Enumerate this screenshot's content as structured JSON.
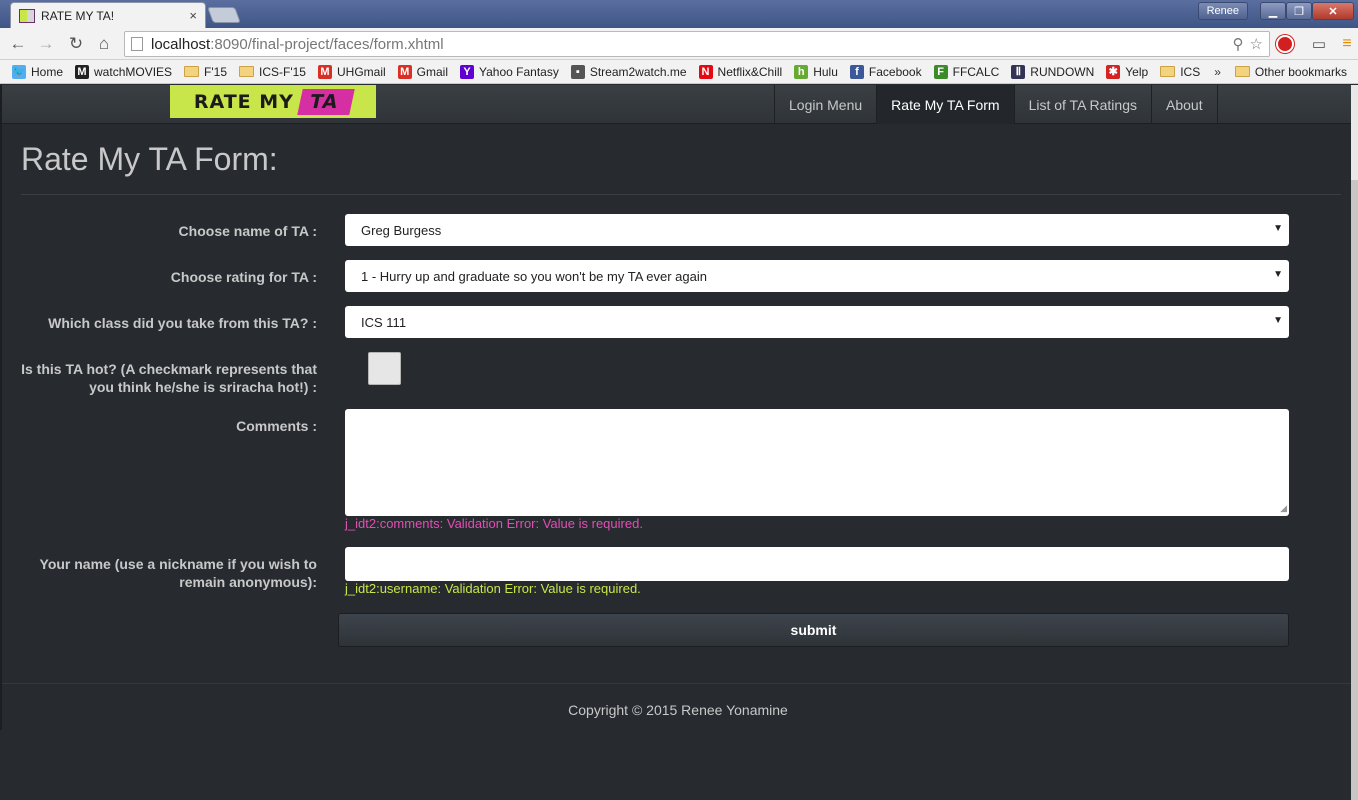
{
  "browser": {
    "tab_title": "RATE MY TA!",
    "tab_close": "×",
    "user_label": "Renee",
    "url_host": "localhost",
    "url_path": ":8090/final-project/faces/form.xhtml",
    "win_min": "▁",
    "win_max": "❐",
    "win_close": "✕"
  },
  "bookmarks": [
    {
      "label": "Home",
      "icon": "twitter-icon",
      "color": "#55acee",
      "glyph": "🐦"
    },
    {
      "label": "watchMOVIES",
      "icon": "m-icon",
      "color": "#222222",
      "glyph": "M"
    },
    {
      "label": "F'15",
      "icon": "folder-icon"
    },
    {
      "label": "ICS-F'15",
      "icon": "folder-icon"
    },
    {
      "label": "UHGmail",
      "icon": "gmail-icon",
      "color": "#d93025",
      "glyph": "M"
    },
    {
      "label": "Gmail",
      "icon": "gmail-icon",
      "color": "#d93025",
      "glyph": "M"
    },
    {
      "label": "Yahoo Fantasy",
      "icon": "yahoo-icon",
      "color": "#5f01d1",
      "glyph": "Y"
    },
    {
      "label": "Stream2watch.me",
      "icon": "stream-icon",
      "color": "#555555",
      "glyph": "▪"
    },
    {
      "label": "Netflix&Chill",
      "icon": "netflix-icon",
      "color": "#e50914",
      "glyph": "N"
    },
    {
      "label": "Hulu",
      "icon": "hulu-icon",
      "color": "#66aa33",
      "glyph": "h"
    },
    {
      "label": "Facebook",
      "icon": "facebook-icon",
      "color": "#3b5998",
      "glyph": "f"
    },
    {
      "label": "FFCALC",
      "icon": "ffcalc-icon",
      "color": "#3d8a2a",
      "glyph": "F"
    },
    {
      "label": "RUNDOWN",
      "icon": "rundown-icon",
      "color": "#333355",
      "glyph": "Ⅱ"
    },
    {
      "label": "Yelp",
      "icon": "yelp-icon",
      "color": "#d32323",
      "glyph": "✱"
    },
    {
      "label": "ICS",
      "icon": "folder-icon"
    }
  ],
  "bookmarks_more": "»",
  "bookmarks_other": "Other bookmarks",
  "site": {
    "brand_left": "RATE MY",
    "brand_right": "TA",
    "nav": [
      "Login Menu",
      "Rate My TA Form",
      "List of TA Ratings",
      "About"
    ],
    "active_nav": "Rate My TA Form"
  },
  "form": {
    "title": "Rate My TA Form:",
    "ta_label": "Choose name of TA :",
    "ta_value": "Greg Burgess",
    "rating_label": "Choose rating for TA :",
    "rating_value": "1 - Hurry up and graduate so you won't be my TA ever again",
    "class_label": "Which class did you take from this TA? :",
    "class_value": "ICS 111",
    "hot_label_1": "Is this TA hot? (A checkmark represents that",
    "hot_label_2": "you think he/she is sriracha hot!) :",
    "hot_checked": false,
    "comments_label": "Comments :",
    "comments_value": "",
    "comments_error": "j_idt2:comments: Validation Error: Value is required.",
    "name_label_1": "Your name (use a nickname if you wish to",
    "name_label_2": "remain anonymous):",
    "name_value": "",
    "name_error": "j_idt2:username: Validation Error: Value is required.",
    "submit_label": "submit",
    "dropdown_arrow": "▼"
  },
  "footer": {
    "text": "Copyright © 2015 Renee Yonamine"
  },
  "colors": {
    "background": "#272b30",
    "brand_green": "#c8e64a",
    "brand_pink": "#d52fa3",
    "error_pink": "#e14fb5",
    "error_green": "#c8e64a"
  }
}
